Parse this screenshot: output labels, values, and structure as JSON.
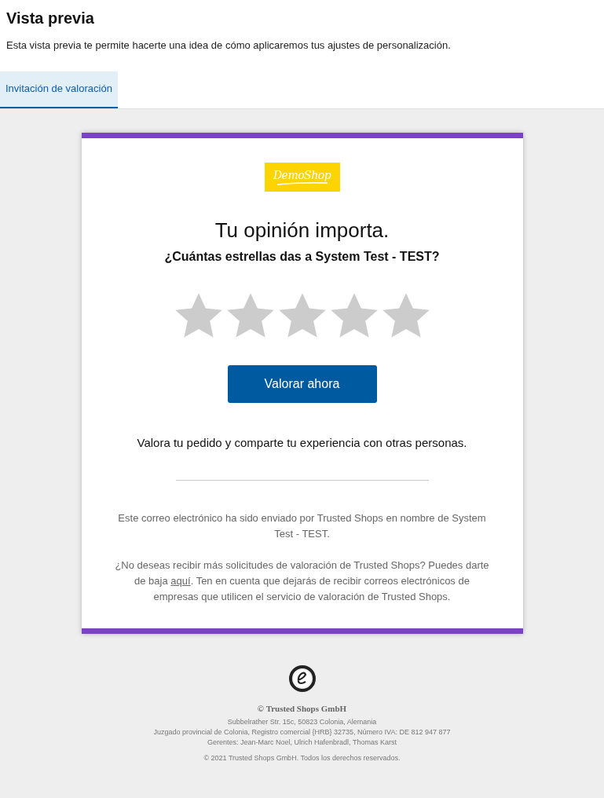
{
  "header": {
    "title": "Vista previa",
    "description": "Esta vista previa te permite hacerte una idea de cómo aplicaremos tus ajustes de personalización."
  },
  "tabs": [
    {
      "label": "Invitación de valoración",
      "selected": true
    }
  ],
  "email": {
    "logo": "DemoShop",
    "heading": "Tu opinión importa.",
    "question": "¿Cuántas estrellas das a System Test - TEST?",
    "rating": {
      "stars": 0
    },
    "button": "Valorar ahora",
    "prompt": "Valora tu pedido y comparte tu experiencia con otras personas.",
    "sender_note": "Este correo electrónico ha sido enviado por Trusted Shops en nombre de System Test - TEST.",
    "unsubscribe": {
      "before": "¿No deseas recibir más solicitudes de valoración de Trusted Shops? Puedes darte de baja",
      "link": "aquí",
      "after": ". Ten en cuenta que dejarás de recibir correos electrónicos de empresas que utilicen el servicio de valoración de Trusted Shops."
    }
  },
  "footer": {
    "company": "© Trusted Shops GmbH",
    "lines": [
      "Subbelrather Str. 15c, 50823 Colonia, Alemania",
      "Juzgado provincial de Colonia, Registro comercial {HRB} 32735, Número IVA: DE 812 947 877",
      "Gerentes: Jean-Marc Noel, Ulrich Hafenbradl, Thomas Karst"
    ],
    "copyright": "© 2021 Trusted Shops GmbH. Todos los derechos reservados."
  }
}
